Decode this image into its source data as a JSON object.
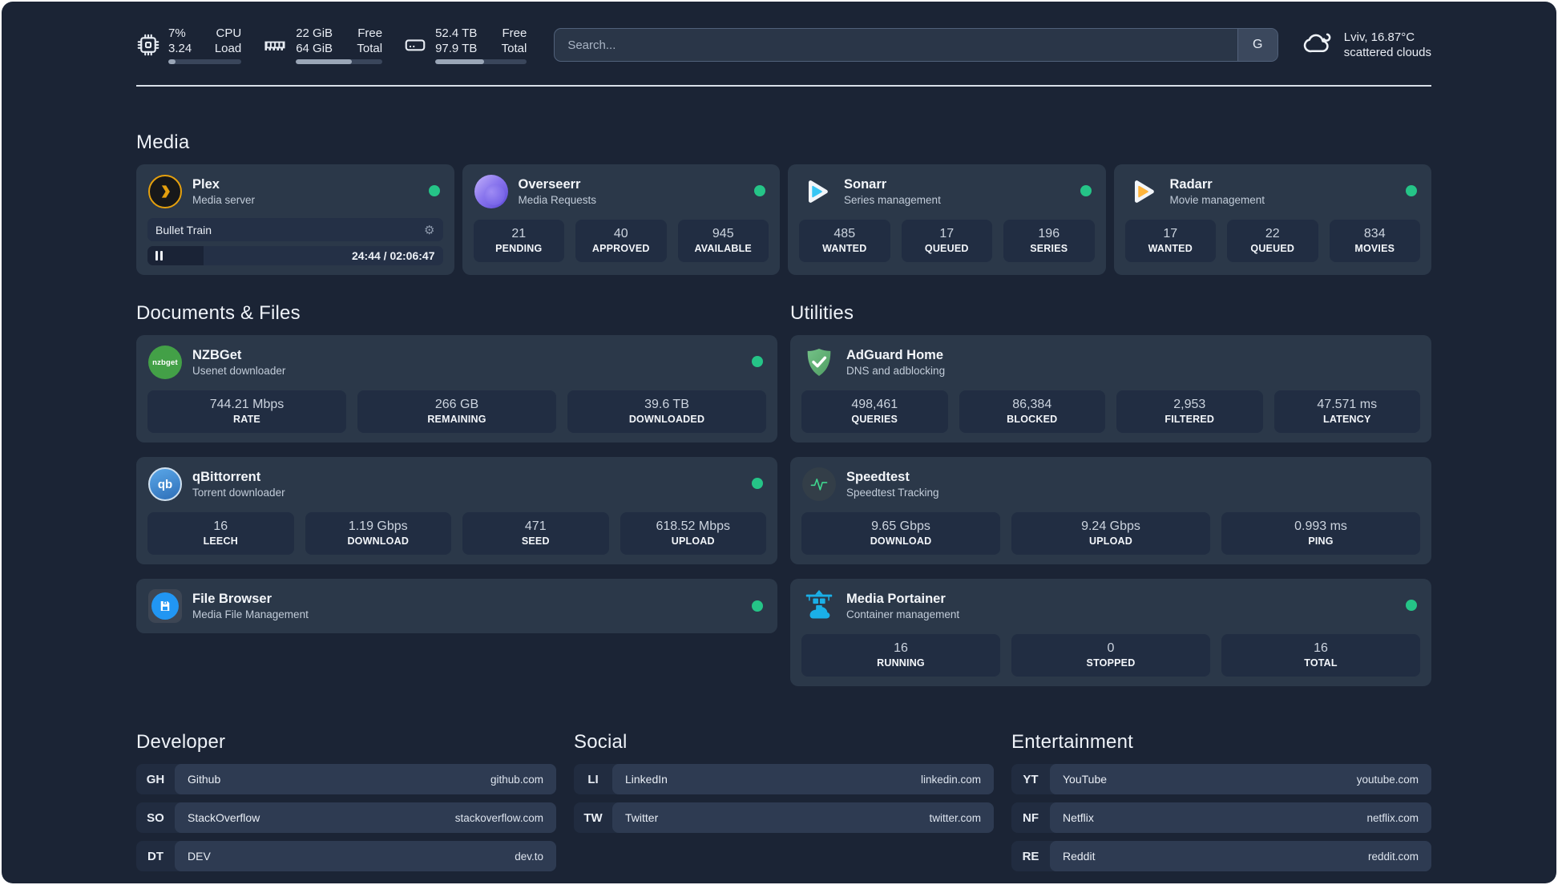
{
  "topbar": {
    "cpu": {
      "line1": "7%",
      "line2": "3.24",
      "label1": "CPU",
      "label2": "Load",
      "progress": "10%"
    },
    "ram": {
      "line1": "22 GiB",
      "line2": "64 GiB",
      "label1": "Free",
      "label2": "Total",
      "progress": "65%"
    },
    "disk": {
      "line1": "52.4 TB",
      "line2": "97.9 TB",
      "label1": "Free",
      "label2": "Total",
      "progress": "53%"
    },
    "search": {
      "placeholder": "Search...",
      "button_label": "G"
    },
    "weather": {
      "location": "Lviv, 16.87°C",
      "condition": "scattered clouds"
    }
  },
  "icons": {
    "cpu": "cpu-chip-icon",
    "ram": "memory-icon",
    "disk": "hdd-icon",
    "search_engine": "google-g-button",
    "weather": "cloud-icon",
    "settings": "gear-icon",
    "pause": "pause-icon",
    "status": "green-status-dot"
  },
  "sections": {
    "media": {
      "title": "Media",
      "plex": {
        "name": "Plex",
        "desc": "Media server",
        "now_playing": "Bullet Train",
        "time": "24:44 / 02:06:47",
        "progress": "19%"
      },
      "overseerr": {
        "name": "Overseerr",
        "desc": "Media Requests",
        "stats": [
          {
            "value": "21",
            "label": "PENDING"
          },
          {
            "value": "40",
            "label": "APPROVED"
          },
          {
            "value": "945",
            "label": "AVAILABLE"
          }
        ]
      },
      "sonarr": {
        "name": "Sonarr",
        "desc": "Series management",
        "stats": [
          {
            "value": "485",
            "label": "WANTED"
          },
          {
            "value": "17",
            "label": "QUEUED"
          },
          {
            "value": "196",
            "label": "SERIES"
          }
        ]
      },
      "radarr": {
        "name": "Radarr",
        "desc": "Movie management",
        "stats": [
          {
            "value": "17",
            "label": "WANTED"
          },
          {
            "value": "22",
            "label": "QUEUED"
          },
          {
            "value": "834",
            "label": "MOVIES"
          }
        ]
      }
    },
    "documents": {
      "title": "Documents & Files",
      "nzbget": {
        "name": "NZBGet",
        "desc": "Usenet downloader",
        "icon_text": "nzbget",
        "stats": [
          {
            "value": "744.21 Mbps",
            "label": "RATE"
          },
          {
            "value": "266 GB",
            "label": "REMAINING"
          },
          {
            "value": "39.6 TB",
            "label": "DOWNLOADED"
          }
        ]
      },
      "qbittorrent": {
        "name": "qBittorrent",
        "desc": "Torrent downloader",
        "icon_text": "qb",
        "stats": [
          {
            "value": "16",
            "label": "LEECH"
          },
          {
            "value": "1.19 Gbps",
            "label": "DOWNLOAD"
          },
          {
            "value": "471",
            "label": "SEED"
          },
          {
            "value": "618.52 Mbps",
            "label": "UPLOAD"
          }
        ]
      },
      "filebrowser": {
        "name": "File Browser",
        "desc": "Media File Management"
      }
    },
    "utilities": {
      "title": "Utilities",
      "adguard": {
        "name": "AdGuard Home",
        "desc": "DNS and adblocking",
        "stats": [
          {
            "value": "498,461",
            "label": "QUERIES"
          },
          {
            "value": "86,384",
            "label": "BLOCKED"
          },
          {
            "value": "2,953",
            "label": "FILTERED"
          },
          {
            "value": "47.571 ms",
            "label": "LATENCY"
          }
        ]
      },
      "speedtest": {
        "name": "Speedtest",
        "desc": "Speedtest Tracking",
        "stats": [
          {
            "value": "9.65 Gbps",
            "label": "DOWNLOAD"
          },
          {
            "value": "9.24 Gbps",
            "label": "UPLOAD"
          },
          {
            "value": "0.993 ms",
            "label": "PING"
          }
        ]
      },
      "portainer": {
        "name": "Media Portainer",
        "desc": "Container management",
        "stats": [
          {
            "value": "16",
            "label": "RUNNING"
          },
          {
            "value": "0",
            "label": "STOPPED"
          },
          {
            "value": "16",
            "label": "TOTAL"
          }
        ]
      }
    }
  },
  "bookmarks": [
    {
      "title": "Developer",
      "items": [
        {
          "abbr": "GH",
          "name": "Github",
          "url": "github.com"
        },
        {
          "abbr": "SO",
          "name": "StackOverflow",
          "url": "stackoverflow.com"
        },
        {
          "abbr": "DT",
          "name": "DEV",
          "url": "dev.to"
        }
      ]
    },
    {
      "title": "Social",
      "items": [
        {
          "abbr": "LI",
          "name": "LinkedIn",
          "url": "linkedin.com"
        },
        {
          "abbr": "TW",
          "name": "Twitter",
          "url": "twitter.com"
        }
      ]
    },
    {
      "title": "Entertainment",
      "items": [
        {
          "abbr": "YT",
          "name": "YouTube",
          "url": "youtube.com"
        },
        {
          "abbr": "NF",
          "name": "Netflix",
          "url": "netflix.com"
        },
        {
          "abbr": "RE",
          "name": "Reddit",
          "url": "reddit.com"
        }
      ]
    }
  ]
}
